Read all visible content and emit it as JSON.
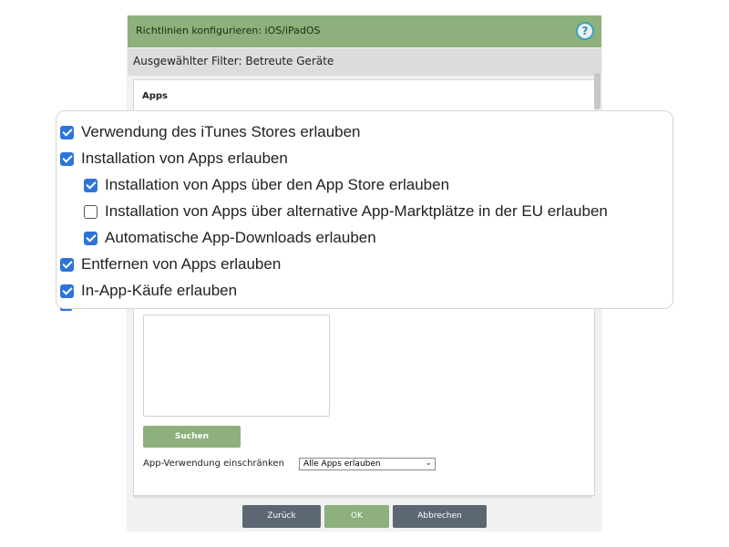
{
  "dialog": {
    "title": "Richtlinien konfigurieren: iOS/iPadOS",
    "help_icon": "?",
    "filter_label": "Ausgewählter Filter: Betreute Geräte",
    "section_heading": "Apps",
    "search_button": "Suchen",
    "restrict_label": "App-Verwendung einschränken",
    "restrict_value": "Alle Apps erlauben",
    "buttons": {
      "back": "Zurück",
      "ok": "OK",
      "cancel": "Abbrechen"
    }
  },
  "options": [
    {
      "label": "Verwendung des iTunes Stores erlauben",
      "checked": true,
      "indent": 0
    },
    {
      "label": "Installation von Apps erlauben",
      "checked": true,
      "indent": 0
    },
    {
      "label": "Installation von Apps über den App Store erlauben",
      "checked": true,
      "indent": 1
    },
    {
      "label": "Installation von Apps über alternative App-Marktplätze in der EU erlauben",
      "checked": false,
      "indent": 1
    },
    {
      "label": "Automatische App-Downloads erlauben",
      "checked": true,
      "indent": 1
    },
    {
      "label": "Entfernen von Apps erlauben",
      "checked": true,
      "indent": 0
    },
    {
      "label": "In-App-Käufe erlauben",
      "checked": true,
      "indent": 0
    }
  ],
  "colors": {
    "accent_green": "#8db07c",
    "checkbox_blue": "#2d74d9",
    "button_gray": "#5c6773"
  }
}
